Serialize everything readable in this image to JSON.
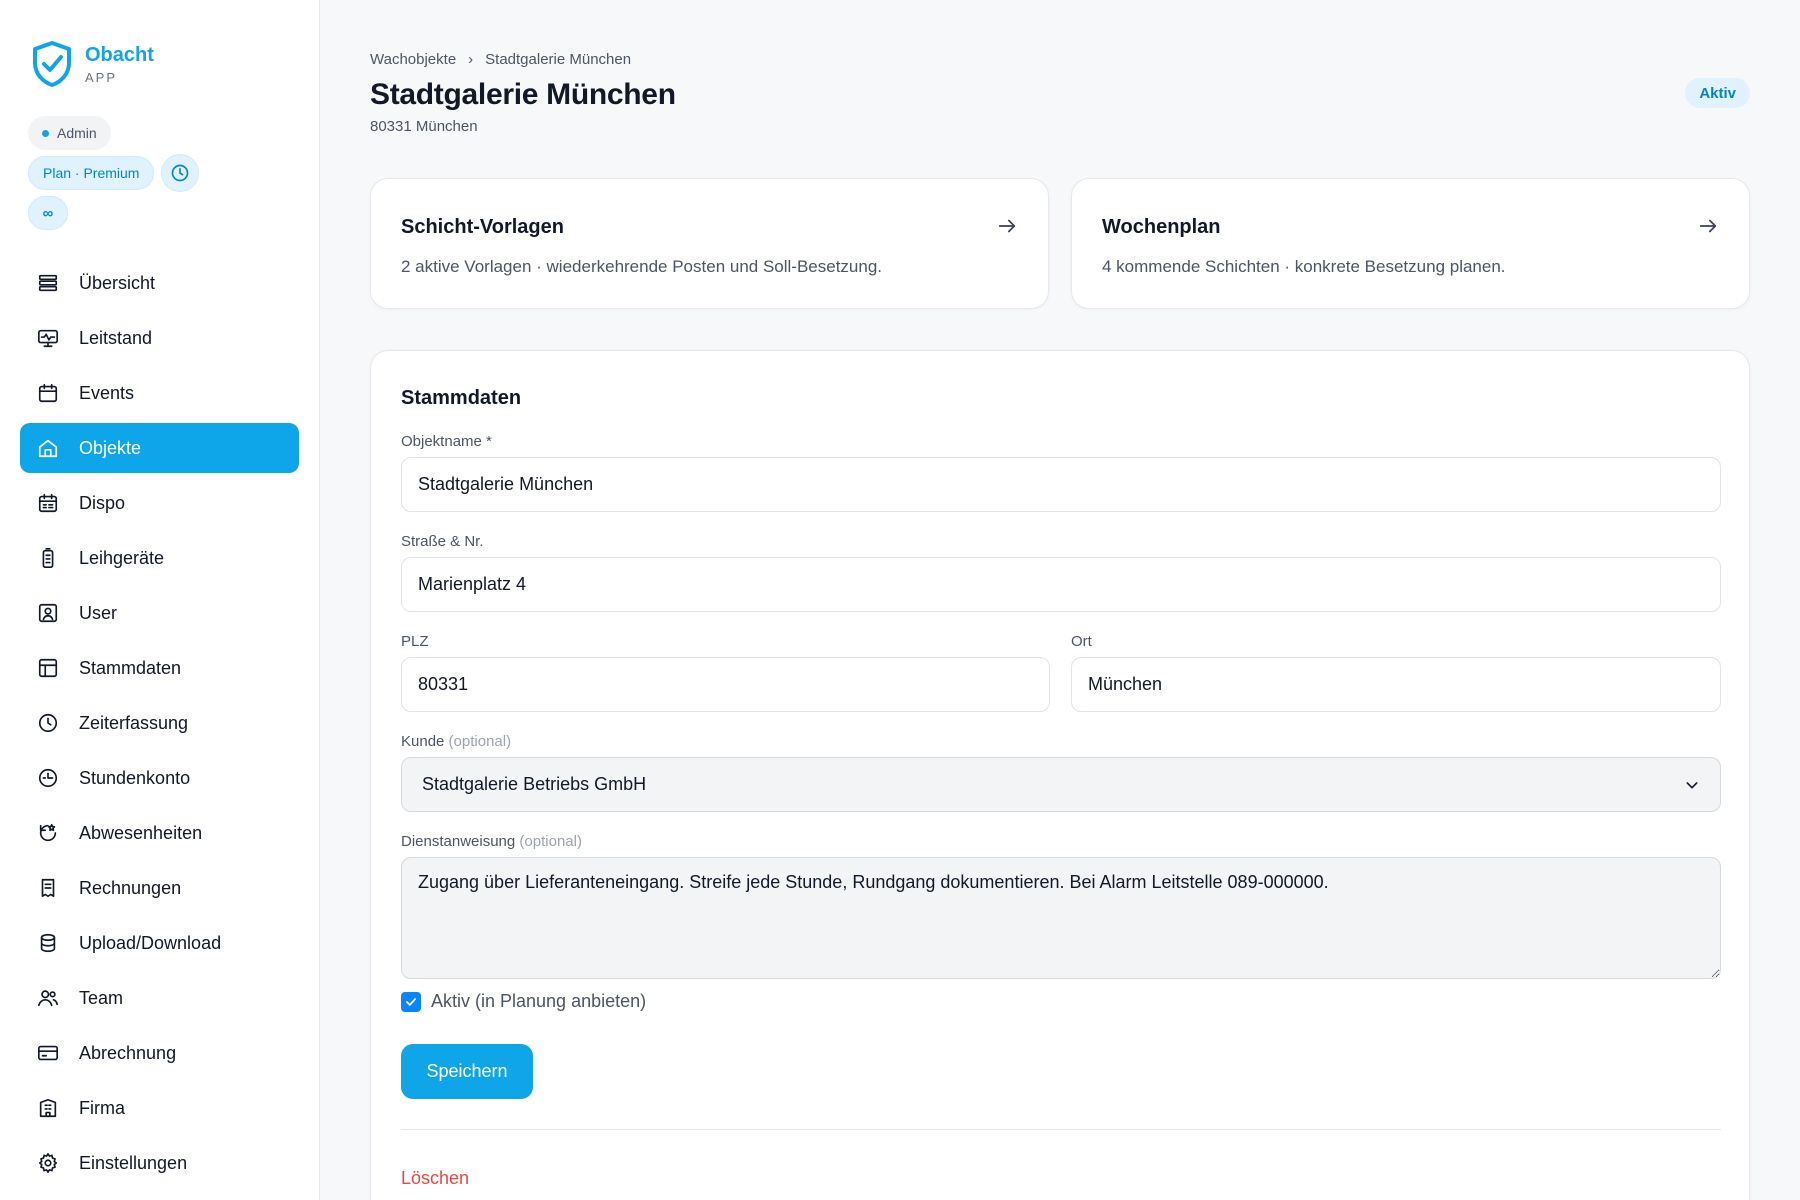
{
  "brand": {
    "name": "Obacht",
    "sub": "APP"
  },
  "badges": {
    "role": "Admin",
    "plan": "Plan · Premium",
    "infinity": "∞"
  },
  "sidebar": {
    "items": [
      {
        "label": "Übersicht",
        "icon": "list-icon"
      },
      {
        "label": "Leitstand",
        "icon": "monitor-icon"
      },
      {
        "label": "Events",
        "icon": "calendar-icon"
      },
      {
        "label": "Objekte",
        "icon": "home-icon",
        "active": true
      },
      {
        "label": "Dispo",
        "icon": "calendar-grid-icon"
      },
      {
        "label": "Leihgeräte",
        "icon": "device-icon"
      },
      {
        "label": "User",
        "icon": "user-square-icon"
      },
      {
        "label": "Stammdaten",
        "icon": "layout-icon"
      },
      {
        "label": "Zeiterfassung",
        "icon": "clock-icon"
      },
      {
        "label": "Stundenkonto",
        "icon": "time-account-icon"
      },
      {
        "label": "Abwesenheiten",
        "icon": "absence-icon"
      },
      {
        "label": "Rechnungen",
        "icon": "invoice-icon"
      },
      {
        "label": "Upload/Download",
        "icon": "database-icon"
      },
      {
        "label": "Team",
        "icon": "users-icon"
      },
      {
        "label": "Abrechnung",
        "icon": "credit-card-icon"
      },
      {
        "label": "Firma",
        "icon": "building-icon"
      },
      {
        "label": "Einstellungen",
        "icon": "gear-icon"
      }
    ]
  },
  "header": {
    "breadcrumb": [
      "Wachobjekte",
      "Stadtgalerie München"
    ],
    "breadcrumb_sep": "›",
    "title": "Stadtgalerie München",
    "subtitle": "80331 München",
    "status": "Aktiv"
  },
  "cards": [
    {
      "title": "Schicht-Vorlagen",
      "desc": "2 aktive Vorlagen · wiederkehrende Posten und Soll-Besetzung."
    },
    {
      "title": "Wochenplan",
      "desc": "4 kommende Schichten · konkrete Besetzung planen."
    }
  ],
  "form": {
    "section_title": "Stammdaten",
    "name_label": "Objektname *",
    "name_value": "Stadtgalerie München",
    "street_label": "Straße & Nr.",
    "street_value": "Marienplatz 4",
    "zip_label": "PLZ",
    "zip_value": "80331",
    "city_label": "Ort",
    "city_value": "München",
    "customer_label": "Kunde",
    "customer_optional": "(optional)",
    "customer_value": "Stadtgalerie Betriebs GmbH",
    "instruction_label": "Dienstanweisung",
    "instruction_optional": "(optional)",
    "instruction_value": "Zugang über Lieferanteneingang. Streife jede Stunde, Rundgang dokumentieren. Bei Alarm Leitstelle 089-000000.",
    "active_label": "Aktiv (in Planung anbieten)",
    "active_checked": true,
    "save_label": "Speichern",
    "delete_label": "Löschen"
  },
  "colors": {
    "accent": "#0ea5e9",
    "danger": "#ef4444",
    "badge_bg": "#e0f2fe"
  }
}
